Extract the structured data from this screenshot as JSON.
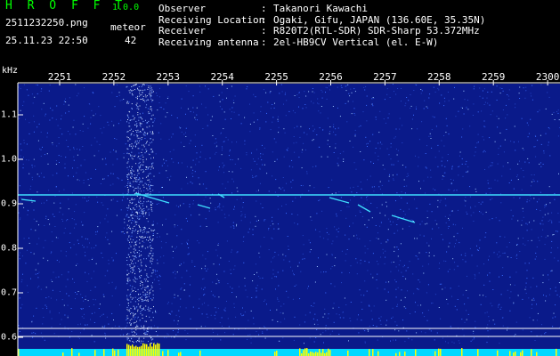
{
  "header": {
    "app_name": "H R O F F T",
    "app_version": "1.0.0",
    "file_name": "2511232250.png",
    "count_label": "meteor",
    "date_time": "25.11.23 22:50",
    "count_value": "42"
  },
  "station_info": [
    {
      "label": "Observer",
      "sep": ":",
      "value": "Takanori Kawachi"
    },
    {
      "label": "Receiving Location",
      "sep": ":",
      "value": "Ogaki, Gifu, JAPAN (136.60E, 35.35N)"
    },
    {
      "label": "Receiver",
      "sep": ":",
      "value": "R820T2(RTL-SDR) SDR-Sharp 53.372MHz"
    },
    {
      "label": "Receiving antenna",
      "sep": ":",
      "value": "2el-HB9CV Vertical (el. E-W)"
    }
  ],
  "spectrogram": {
    "y_unit": "kHz",
    "x_ticks": [
      "2251",
      "2252",
      "2253",
      "2254",
      "2255",
      "2256",
      "2257",
      "2258",
      "2259",
      "2300"
    ],
    "y_ticks": [
      "1.1",
      "1.0",
      "0.9",
      "0.8",
      "0.7",
      "0.6"
    ],
    "y_tick_values": [
      1.1,
      1.0,
      0.9,
      0.8,
      0.7,
      0.6
    ],
    "y_range": [
      0.58,
      1.19
    ],
    "carrier_frequency": 0.92,
    "colors": {
      "background": "#0a1a8a",
      "noise": "#3a6cff",
      "carrier": "#40e0ff",
      "axis": "#ffffff",
      "activity": "#ffff00",
      "activity_base": "#00d8ff"
    }
  }
}
